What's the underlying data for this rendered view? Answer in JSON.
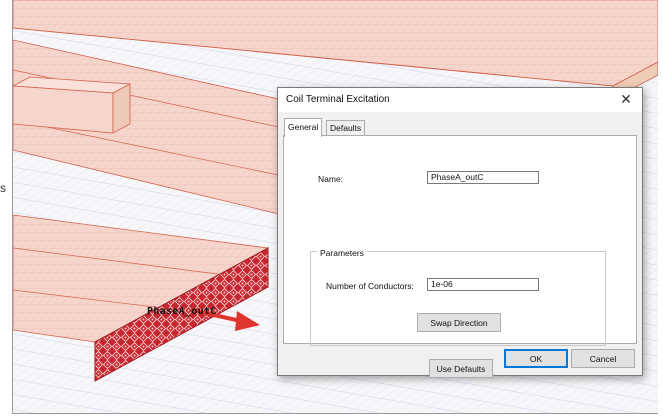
{
  "dialog": {
    "title": "Coil Terminal Excitation",
    "close_glyph": "✕",
    "tabs": [
      {
        "label": "General",
        "active": true
      },
      {
        "label": "Defaults",
        "active": false
      }
    ],
    "name_label": "Name:",
    "name_value": "PhaseA_outC",
    "parameters_group_title": "Parameters",
    "conductors_label": "Number of Conductors:",
    "conductors_value": "1e-06",
    "swap_direction_button": "Swap Direction",
    "use_defaults_button": "Use Defaults",
    "ok_button": "OK",
    "cancel_button": "Cancel"
  },
  "model_view": {
    "coil_terminal_label": "PhaseA_outC",
    "edge_glyph": "s"
  },
  "colors": {
    "coil_fill": "#f6d5cc",
    "coil_edge": "#d2604b",
    "terminal_face": "#c8262f",
    "arrow": "#e0342e",
    "grid": "#c6cde6",
    "dialog_bg": "#f0f0f0",
    "focus_accent": "#0078d7"
  },
  "icons": {
    "close": "close-icon",
    "direction_arrow": "arrow-right-icon"
  }
}
